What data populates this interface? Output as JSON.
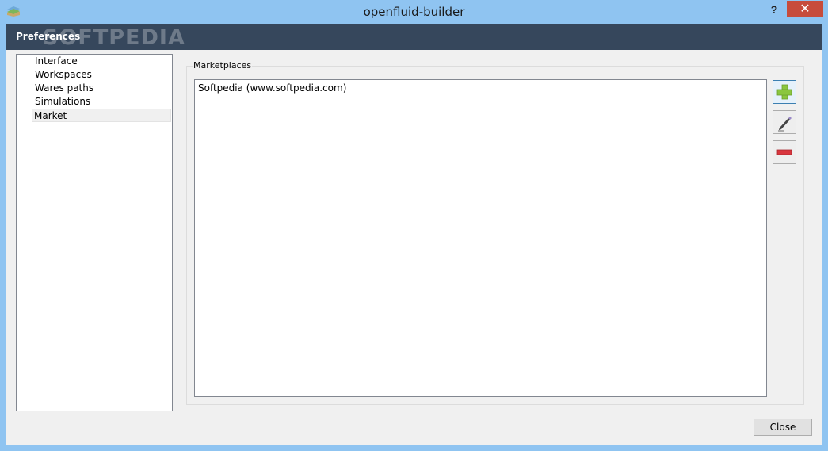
{
  "window": {
    "title": "openfluid-builder",
    "help_label": "?",
    "close_label": "✕",
    "icon": "openfluid-app-icon"
  },
  "header": {
    "title": "Preferences",
    "watermark": "SOFTPEDIA"
  },
  "nav": {
    "items": [
      {
        "label": "Interface",
        "selected": false
      },
      {
        "label": "Workspaces",
        "selected": false
      },
      {
        "label": "Wares paths",
        "selected": false
      },
      {
        "label": "Simulations",
        "selected": false
      },
      {
        "label": "Market",
        "selected": true
      }
    ]
  },
  "marketplaces": {
    "group_label": "Marketplaces",
    "items": [
      "Softpedia (www.softpedia.com)"
    ],
    "buttons": [
      {
        "icon": "plus-icon",
        "color": "#8bc63f"
      },
      {
        "icon": "pencil-icon",
        "color": "#333333"
      },
      {
        "icon": "minus-icon",
        "color": "#d9363e"
      }
    ]
  },
  "footer": {
    "close_label": "Close"
  },
  "colors": {
    "titlebar": "#8fc4f1",
    "header": "#36475c",
    "close_window": "#c74c3c"
  }
}
